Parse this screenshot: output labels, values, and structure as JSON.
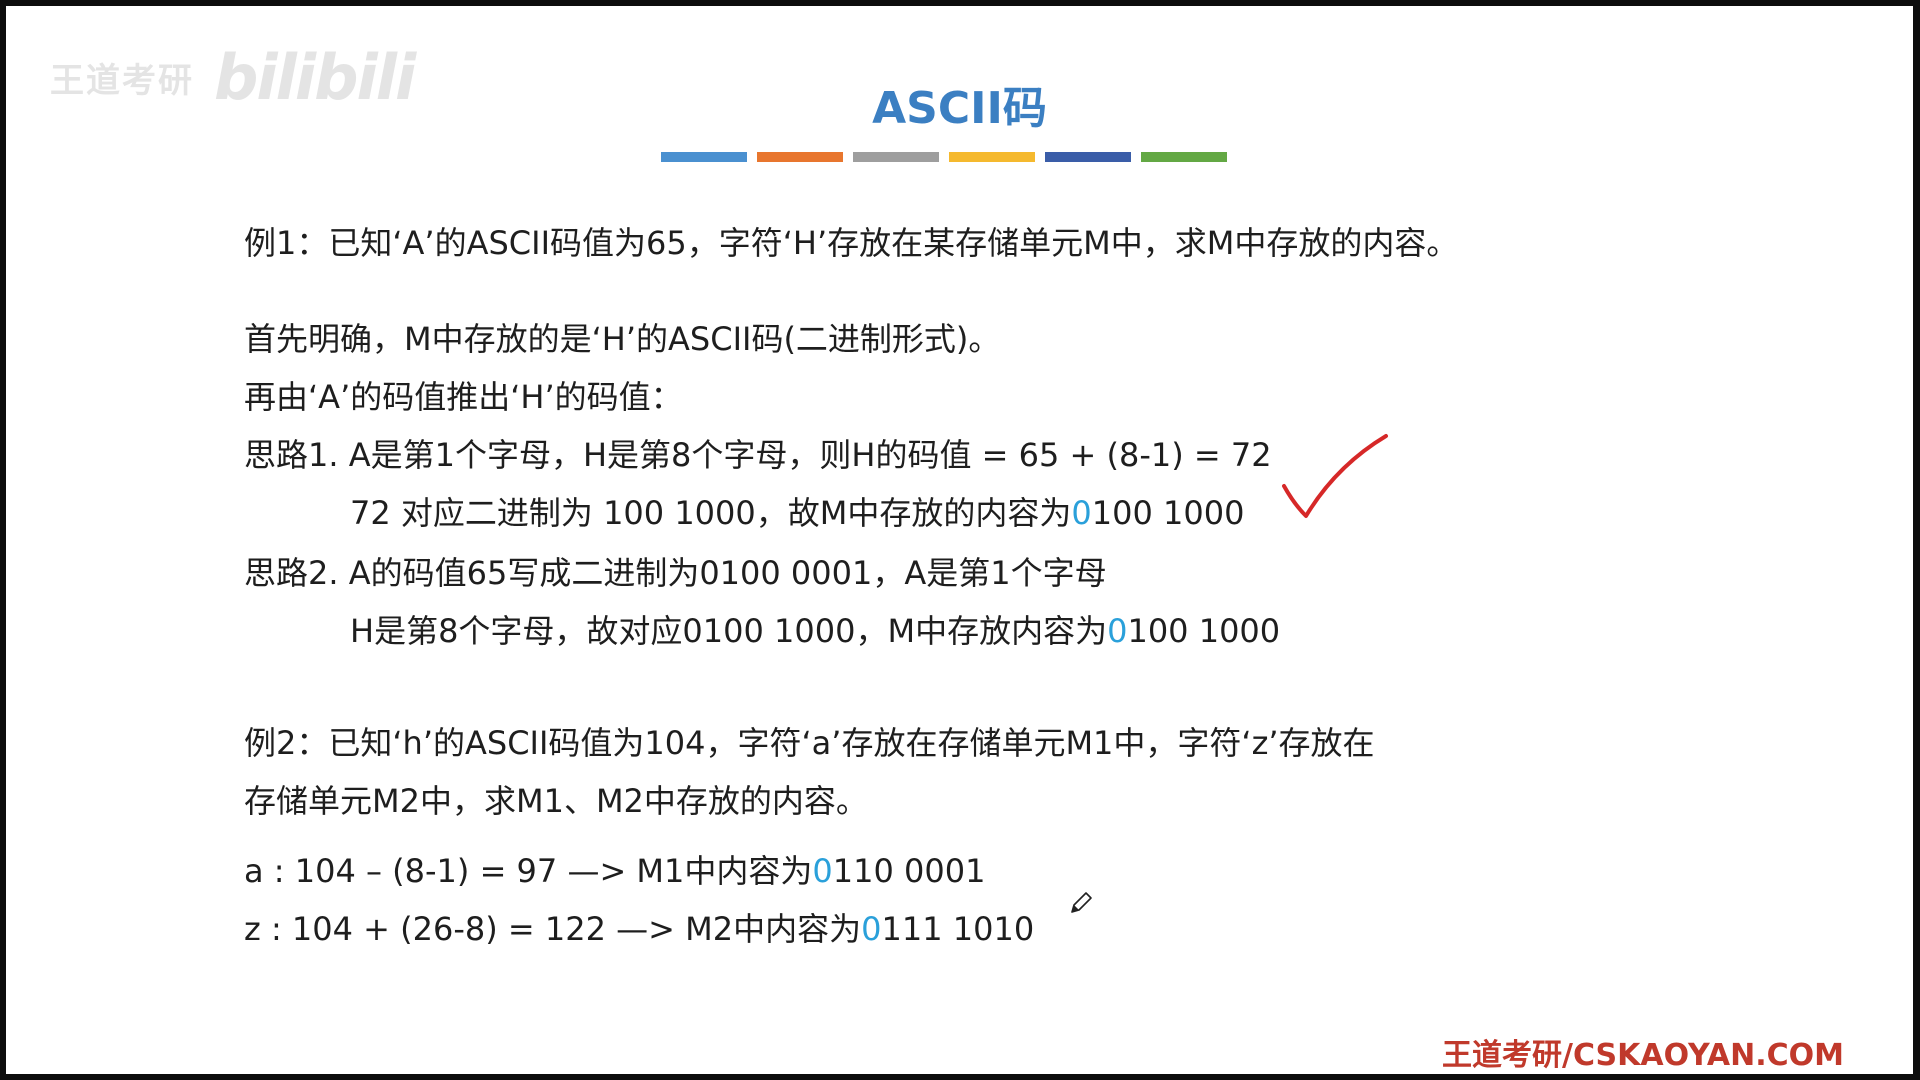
{
  "watermark": {
    "brand_text": "王道考研",
    "platform_text": "bilibili"
  },
  "slide": {
    "title": "ASCII码",
    "color_bar": [
      "#4a90d0",
      "#e8762e",
      "#9e9e9e",
      "#f5b92e",
      "#3a5da8",
      "#63a844"
    ],
    "example1": {
      "question": "例1：已知‘A’的ASCII码值为65，字符‘H’存放在某存储单元M中，求M中存放的内容。",
      "line1": "首先明确，M中存放的是‘H’的ASCII码(二进制形式)。",
      "line2": "再由‘A’的码值推出‘H’的码值：",
      "idea1_a": "思路1. A是第1个字母，H是第8个字母，则H的码值 = 65 + (8-1)  = 72",
      "idea1_b_pre": "72 对应二进制为 100 1000，故M中存放的内容为",
      "idea1_b_hl": "0",
      "idea1_b_post": "100 1000",
      "idea2_a": "思路2. A的码值65写成二进制为0100 0001，A是第1个字母",
      "idea2_b_pre": "H是第8个字母，故对应0100 1000，M中存放内容为",
      "idea2_b_hl": "0",
      "idea2_b_post": "100 1000"
    },
    "example2": {
      "question_l1": "例2：已知‘h’的ASCII码值为104，字符‘a’存放在存储单元M1中，字符‘z’存放在",
      "question_l2": "存储单元M2中，求M1、M2中存放的内容。",
      "calc_a_pre": "a : 104 – (8-1) = 97  —> M1中内容为",
      "calc_a_hl": "0",
      "calc_a_post": "110 0001",
      "calc_z_pre": "z : 104 + (26-8) = 122 —> M2中内容为",
      "calc_z_hl": "0",
      "calc_z_post": "111 1010"
    },
    "footer": "王道考研/CSKAOYAN.COM"
  },
  "colors": {
    "title": "#3b7fc2",
    "highlight": "#2aa0da",
    "checkmark": "#d62828",
    "footer": "#c0392b"
  },
  "icons": {
    "checkmark": "checkmark-icon",
    "pencil": "pencil-icon"
  }
}
